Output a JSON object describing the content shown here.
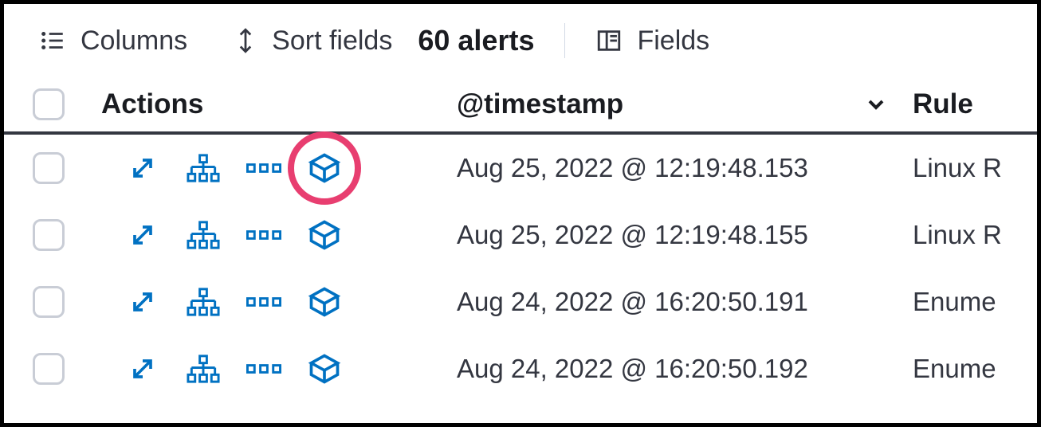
{
  "toolbar": {
    "columns_label": "Columns",
    "sort_label": "Sort fields",
    "alerts_label": "60 alerts",
    "fields_label": "Fields"
  },
  "headers": {
    "actions": "Actions",
    "timestamp": "@timestamp",
    "rule": "Rule"
  },
  "rows": [
    {
      "timestamp": "Aug 25, 2022 @ 12:19:48.153",
      "rule": "Linux R",
      "highlighted": true
    },
    {
      "timestamp": "Aug 25, 2022 @ 12:19:48.155",
      "rule": "Linux R",
      "highlighted": false
    },
    {
      "timestamp": "Aug 24, 2022 @ 16:20:50.191",
      "rule": "Enume",
      "highlighted": false
    },
    {
      "timestamp": "Aug 24, 2022 @ 16:20:50.192",
      "rule": "Enume",
      "highlighted": false
    }
  ]
}
